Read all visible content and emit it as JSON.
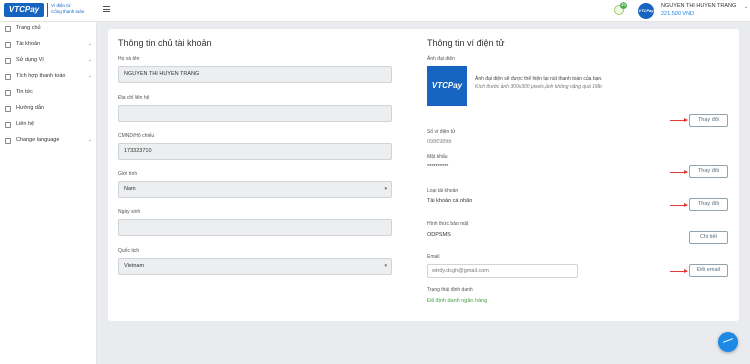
{
  "header": {
    "logo_text": "VTCPay",
    "tagline_line1": "Ví điện tử",
    "tagline_line2": "Cổng thanh toán",
    "notification_count": "10",
    "avatar_text": "VTCPay",
    "user_name": "NGUYEN THI HUYEN TRANG",
    "balance": "221.500 VND"
  },
  "sidebar": {
    "items": [
      {
        "label": "Trang chủ",
        "icon": "home-icon"
      },
      {
        "label": "Tài khoản",
        "icon": "user-icon"
      },
      {
        "label": "Sử dụng Ví",
        "icon": "wallet-icon"
      },
      {
        "label": "Tích hợp thanh toán",
        "icon": "link-icon"
      },
      {
        "label": "Tin tức",
        "icon": "news-icon"
      },
      {
        "label": "Hướng dẫn",
        "icon": "guide-icon"
      },
      {
        "label": "Liên hệ",
        "icon": "contact-icon"
      },
      {
        "label": "Change language",
        "icon": "language-icon"
      }
    ]
  },
  "owner": {
    "title": "Thông tin chủ tài khoản",
    "name_label": "Họ và tên",
    "name_value": "NGUYEN THI HUYEN TRANG",
    "address_label": "Địa chỉ liên hệ",
    "address_value": "",
    "id_label": "CMND/Hộ chiếu",
    "id_value": "173323710",
    "gender_label": "Giới tính",
    "gender_value": "Nam",
    "dob_label": "Ngày sinh",
    "dob_value": "",
    "nationality_label": "Quốc tịch",
    "nationality_value": "Vietnam"
  },
  "wallet": {
    "title": "Thông tin ví điện tử",
    "avatar_label": "Ảnh đại diện",
    "avatar_img_text": "VTCPay",
    "avatar_desc": "Ảnh đại diện sẽ được thể hiện tại nút thanh toán của bạn.",
    "avatar_note": "Kích thước ảnh 300x300 pixels,ảnh không nặng quá 1Mb",
    "change_btn": "Thay đổi",
    "wallet_no_label": "Số ví điện tử",
    "wallet_no_value": "098€98tttt",
    "password_label": "Mật khẩu",
    "password_value": "**********",
    "account_type_label": "Loại tài khoản",
    "account_type_value": "Tài khoản cá nhân",
    "security_label": "Hình thức bảo mật",
    "security_value": "ODPSMS",
    "detail_btn": "Chi tiết",
    "email_label": "Email",
    "email_value": "wtrdy.dcgh@gmail.com",
    "change_email_btn": "Đổi email",
    "verification_label": "Trạng thái định danh",
    "verification_value": "Đã định danh ngân hàng"
  }
}
